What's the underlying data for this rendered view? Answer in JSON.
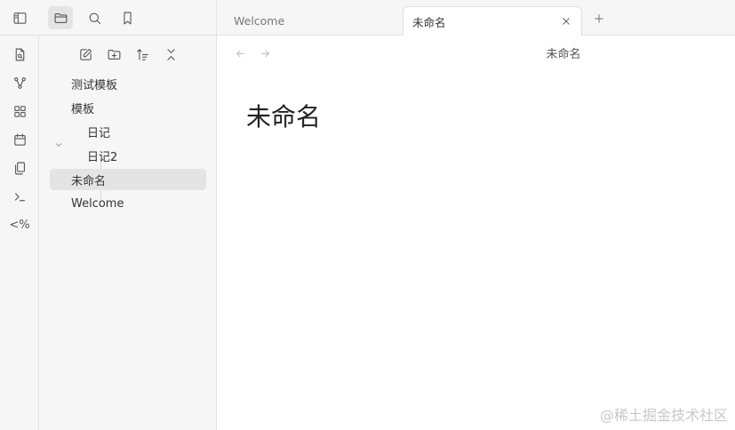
{
  "sidebar_top": {
    "icons": [
      "sidebar-toggle-icon",
      "folder-icon",
      "search-icon",
      "bookmark-icon"
    ]
  },
  "ribbon": {
    "icons": [
      "open-quick-switcher-icon",
      "graph-view-icon",
      "canvas-icon",
      "daily-note-icon",
      "templates-icon",
      "command-palette-icon",
      "templater-icon"
    ],
    "templater_label": "<%"
  },
  "explorer": {
    "toolbar": [
      "new-note-icon",
      "new-folder-icon",
      "sort-icon",
      "collapse-all-icon"
    ],
    "items": [
      {
        "label": "测试模板",
        "depth": 0
      },
      {
        "label": "模板",
        "depth": 0,
        "folder": true,
        "expanded": true
      },
      {
        "label": "日记",
        "depth": 1
      },
      {
        "label": "日记2",
        "depth": 1
      },
      {
        "label": "未命名",
        "depth": 0,
        "selected": true
      },
      {
        "label": "Welcome",
        "depth": 0
      }
    ]
  },
  "tabs": [
    {
      "label": "Welcome",
      "active": false
    },
    {
      "label": "未命名",
      "active": true
    }
  ],
  "editor": {
    "view_title": "未命名",
    "note_title": "未命名"
  },
  "watermark": "@稀土掘金技术社区"
}
